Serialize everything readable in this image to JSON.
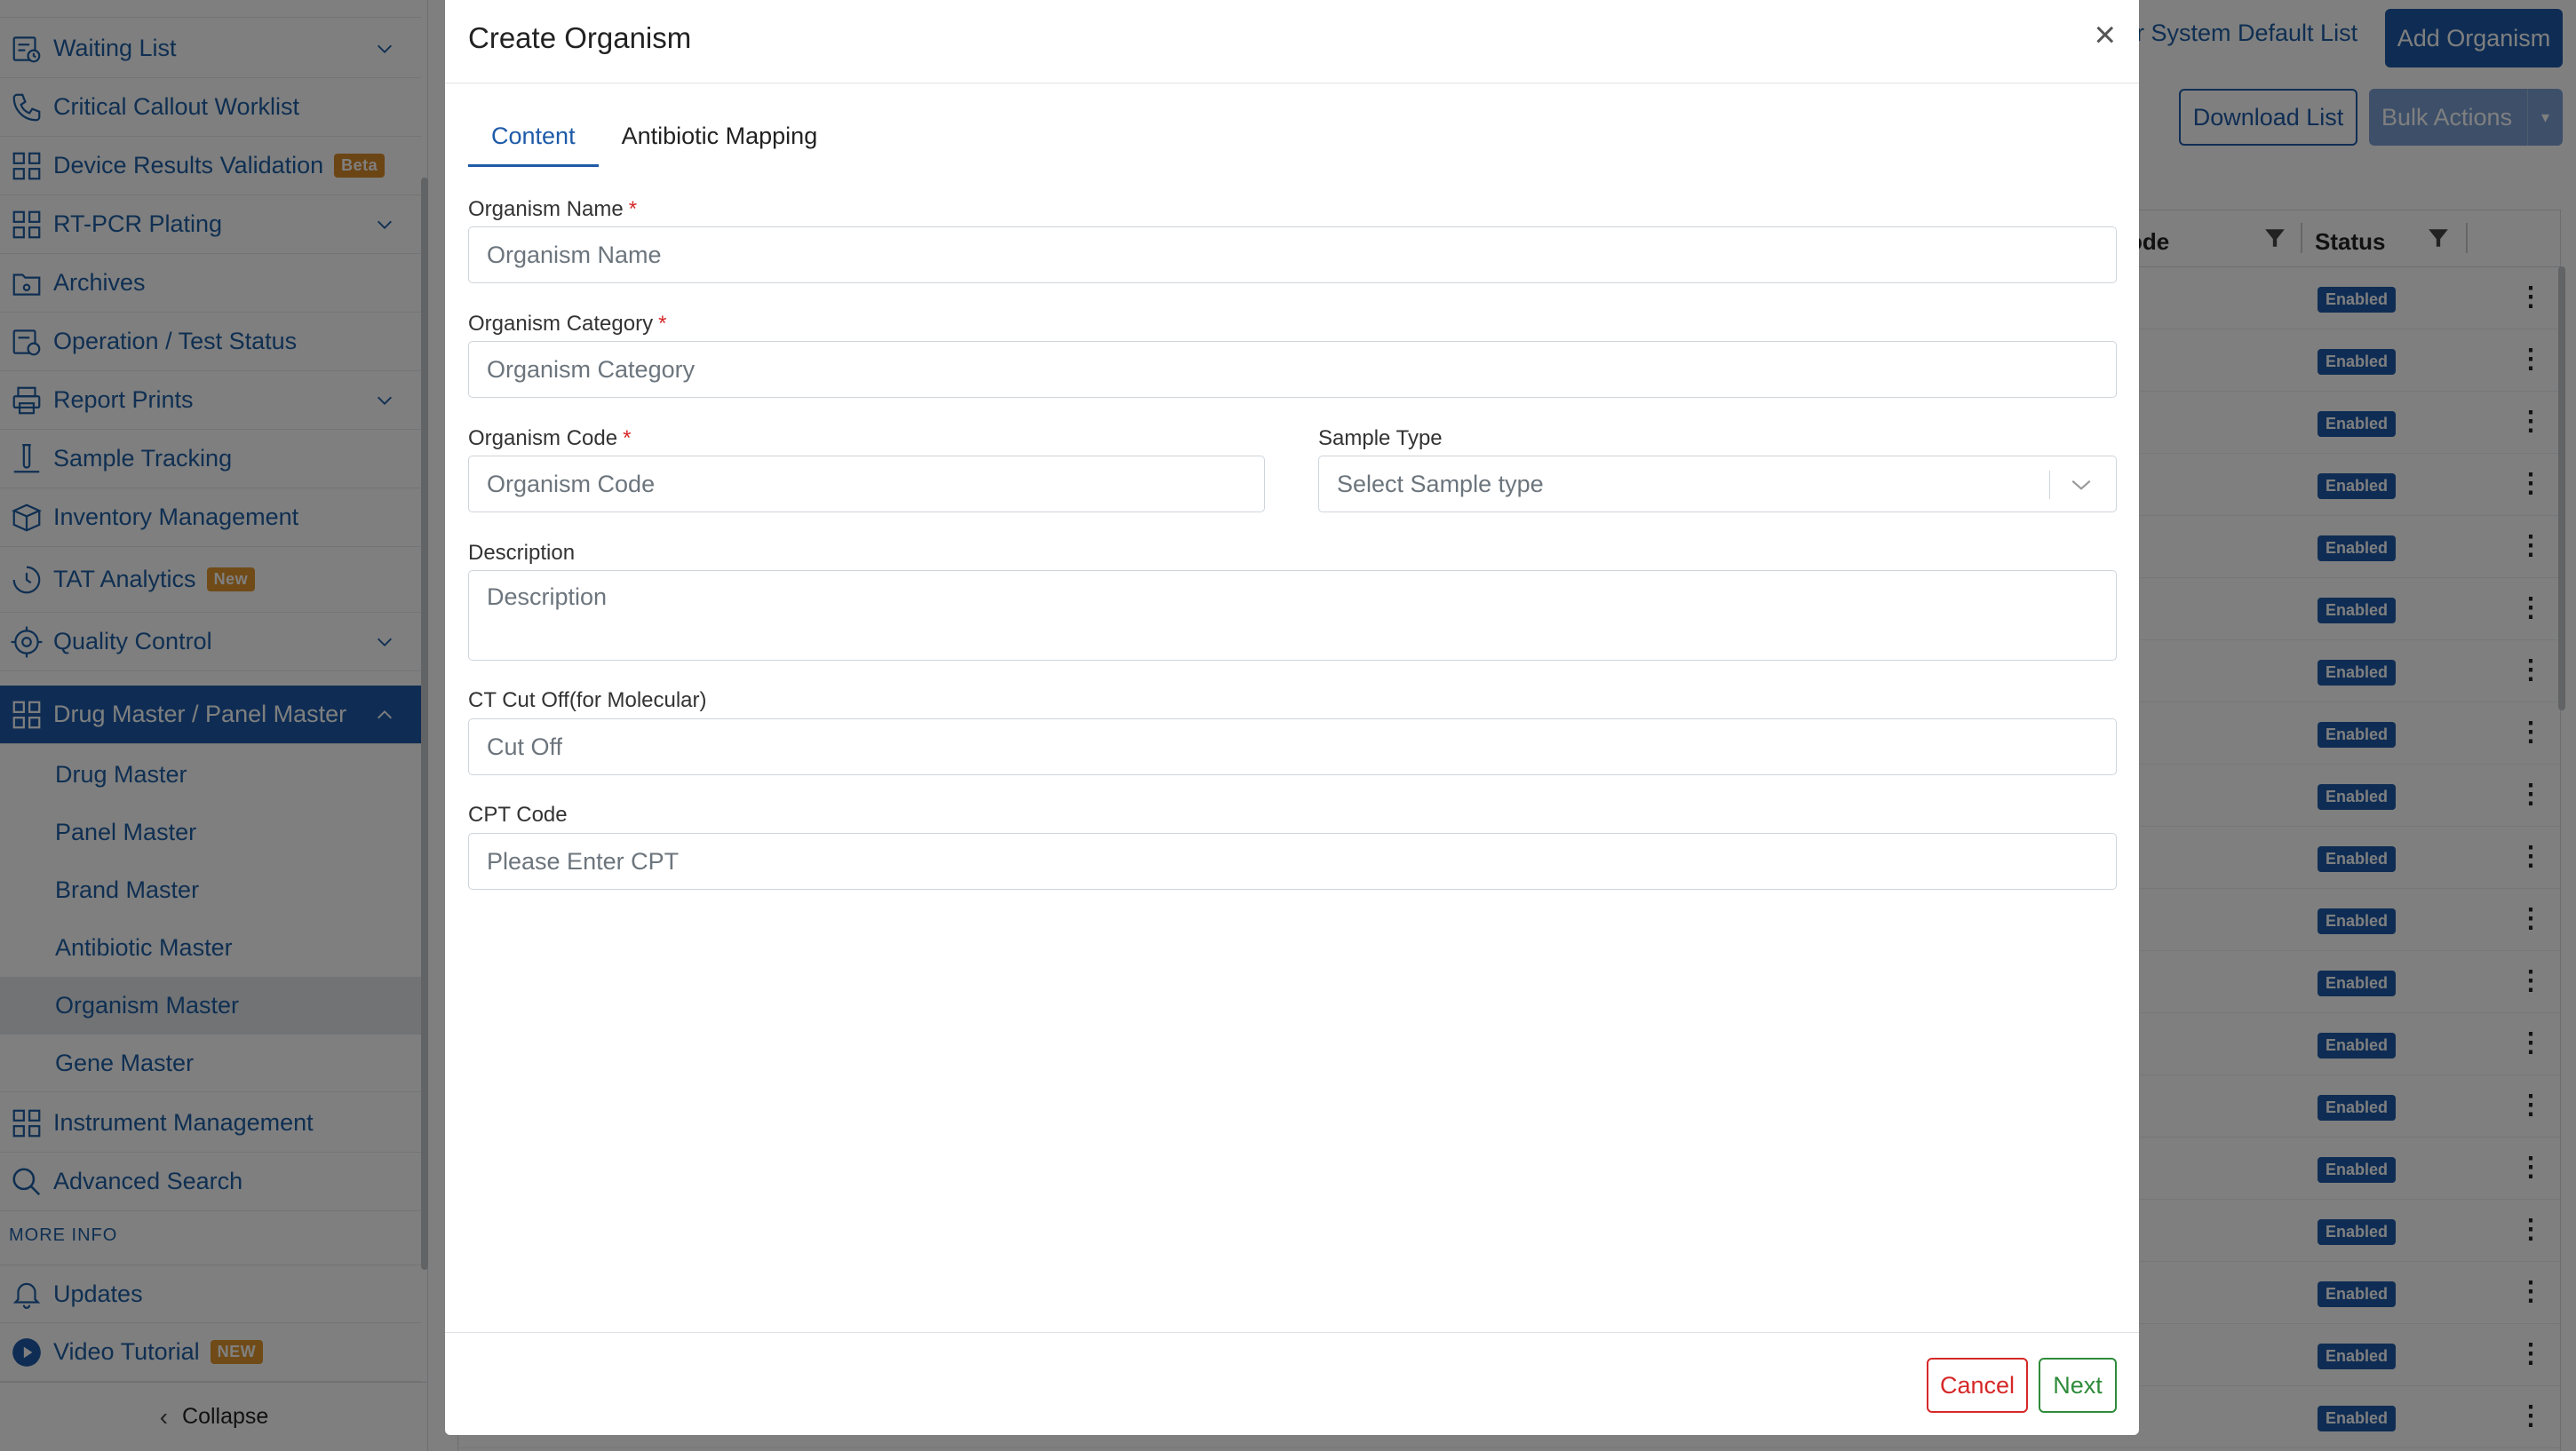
{
  "sidebar": {
    "items": [
      {
        "label": "Waiting List",
        "icon": "waiting-list-icon",
        "expandable": true
      },
      {
        "label": "Critical Callout Worklist",
        "icon": "phone-icon",
        "expandable": false
      },
      {
        "label": "Device Results Validation",
        "icon": "grid-icon",
        "badge": "Beta",
        "expandable": false
      },
      {
        "label": "RT-PCR Plating",
        "icon": "grid-icon",
        "expandable": true
      },
      {
        "label": "Archives",
        "icon": "archive-icon",
        "expandable": false
      },
      {
        "label": "Operation / Test Status",
        "icon": "operation-icon",
        "expandable": false
      },
      {
        "label": "Report Prints",
        "icon": "printer-icon",
        "expandable": true
      },
      {
        "label": "Sample Tracking",
        "icon": "test-tube-icon",
        "expandable": false
      },
      {
        "label": "Inventory Management",
        "icon": "box-icon",
        "expandable": false
      },
      {
        "label": "TAT Analytics",
        "icon": "clock-icon",
        "badge": "New",
        "expandable": false
      },
      {
        "label": "Quality Control",
        "icon": "gear-icon",
        "expandable": true
      },
      {
        "label": "Drug Master / Panel Master",
        "icon": "grid-icon",
        "expandable": true,
        "active": true
      },
      {
        "label": "Instrument Management",
        "icon": "grid-icon",
        "expandable": false
      },
      {
        "label": "Advanced Search",
        "icon": "search-icon",
        "expandable": false
      },
      {
        "label": "Updates",
        "icon": "bell-icon",
        "expandable": false
      },
      {
        "label": "Video Tutorial",
        "icon": "play-icon",
        "badge": "NEW",
        "expandable": false
      }
    ],
    "sub_items": [
      "Drug Master",
      "Panel Master",
      "Brand Master",
      "Antibiotic Master",
      "Organism Master",
      "Gene Master"
    ],
    "selected_sub_item": "Organism Master",
    "more_info_label": "MORE INFO",
    "collapse_label": "Collapse"
  },
  "page": {
    "system_default_link": "r System Default List",
    "add_button": "Add Organism",
    "download_button": "Download List",
    "bulk_button": "Bulk Actions",
    "table": {
      "columns": [
        "ode",
        "Status"
      ],
      "rows": [
        "Enabled",
        "Enabled",
        "Enabled",
        "Enabled",
        "Enabled",
        "Enabled",
        "Enabled",
        "Enabled",
        "Enabled",
        "Enabled",
        "Enabled",
        "Enabled",
        "Enabled",
        "Enabled",
        "Enabled",
        "Enabled",
        "Enabled",
        "Enabled",
        "Enabled"
      ]
    }
  },
  "modal": {
    "title": "Create Organism",
    "close": "×",
    "tabs": [
      "Content",
      "Antibiotic Mapping"
    ],
    "active_tab": "Content",
    "fields": {
      "name": {
        "label": "Organism Name",
        "placeholder": "Organism Name",
        "required": "*"
      },
      "category": {
        "label": "Organism Category",
        "placeholder": "Organism Category",
        "required": "*"
      },
      "code": {
        "label": "Organism Code",
        "placeholder": "Organism Code",
        "required": "*"
      },
      "sample_type": {
        "label": "Sample Type",
        "placeholder": "Select Sample type"
      },
      "description": {
        "label": "Description",
        "placeholder": "Description"
      },
      "ct_cutoff": {
        "label": "CT Cut Off(for Molecular)",
        "placeholder": "Cut Off"
      },
      "cpt": {
        "label": "CPT Code",
        "placeholder": "Please Enter CPT"
      }
    },
    "cancel_button": "Cancel",
    "next_button": "Next"
  },
  "colors": {
    "primary": "#1e5aa8",
    "link": "#1f5fa5",
    "danger": "#d62828",
    "success": "#2e8b3a",
    "badge_orange": "#e0962f"
  }
}
